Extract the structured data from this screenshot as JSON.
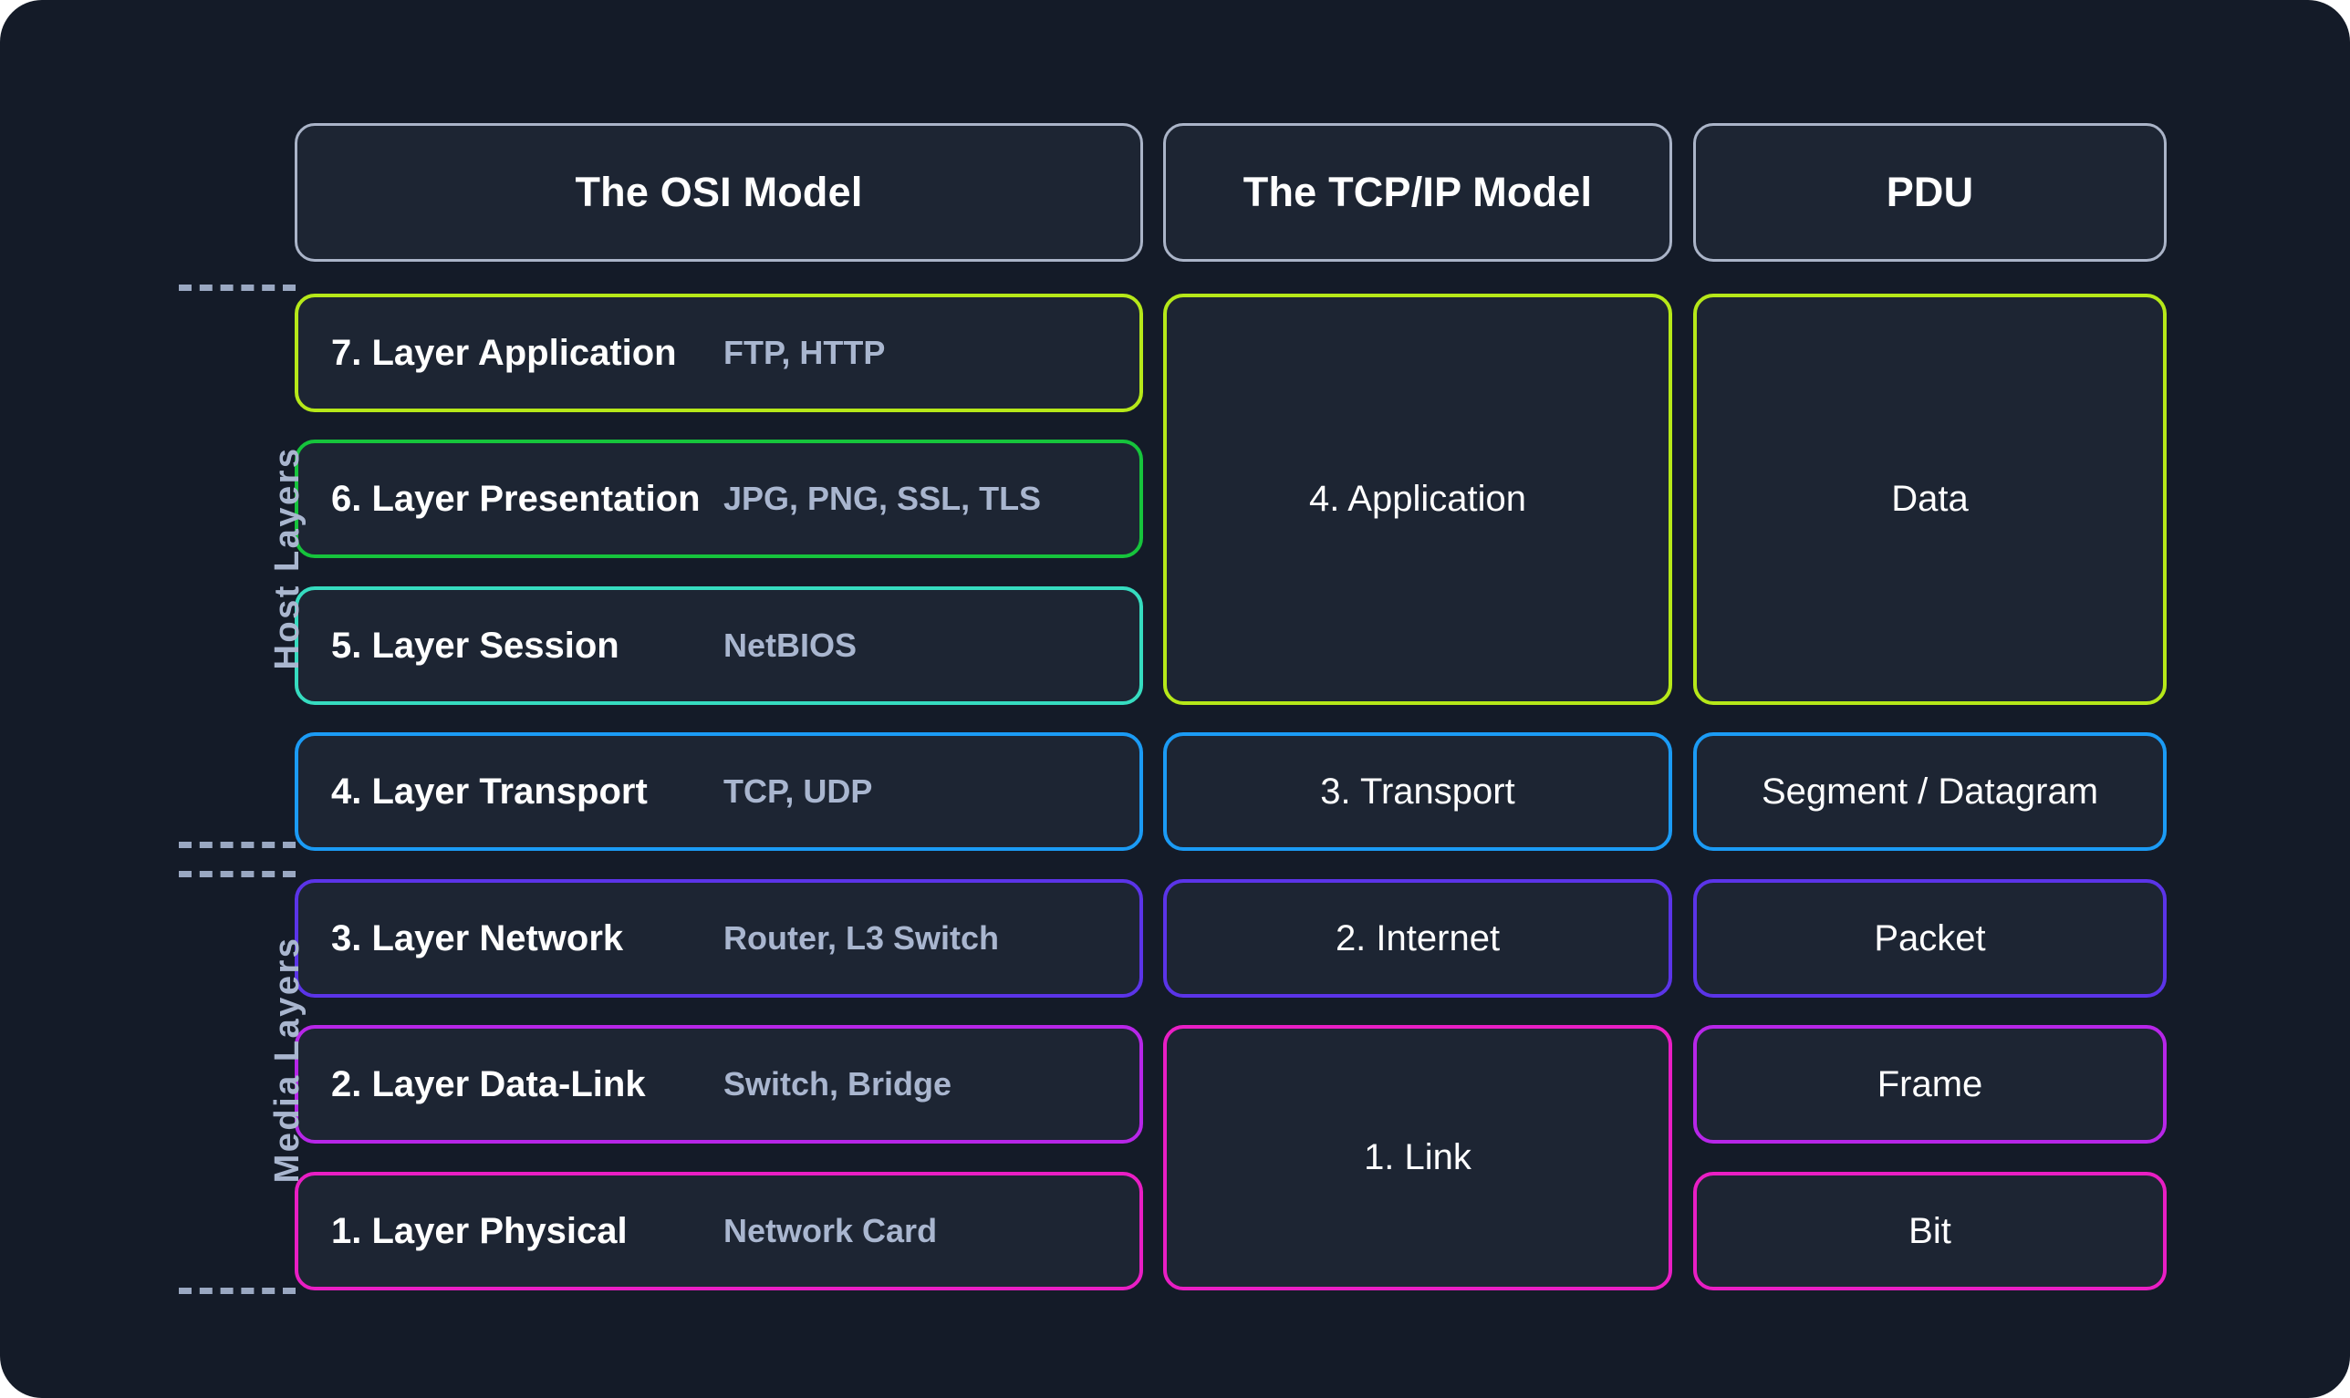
{
  "canvas": {
    "background": "#141b28",
    "box_fill": "#1d2533",
    "neutral_border": "#aab4c8",
    "muted_text": "#a9b6cf",
    "primary_text": "#ffffff"
  },
  "headers": [
    {
      "label": "The OSI Model",
      "color": "#aab4c8"
    },
    {
      "label": "The TCP/IP Model",
      "color": "#aab4c8"
    },
    {
      "label": "PDU",
      "color": "#aab4c8"
    }
  ],
  "group_labels": [
    {
      "label": "Host Layers"
    },
    {
      "label": "Media Layers"
    }
  ],
  "osi_layers": [
    {
      "name": "7. Layer Application",
      "protocols": "FTP, HTTP",
      "color": "#b6e819"
    },
    {
      "name": "6. Layer Presentation",
      "protocols": "JPG, PNG, SSL, TLS",
      "color": "#16c43c"
    },
    {
      "name": "5. Layer Session",
      "protocols": "NetBIOS",
      "color": "#36dcc0"
    },
    {
      "name": "4. Layer Transport",
      "protocols": "TCP, UDP",
      "color": "#1b9bf5"
    },
    {
      "name": "3. Layer Network",
      "protocols": "Router, L3 Switch",
      "color": "#5b34e8"
    },
    {
      "name": "2. Layer Data-Link",
      "protocols": "Switch, Bridge",
      "color": "#b726e8"
    },
    {
      "name": "1. Layer Physical",
      "protocols": "Network Card",
      "color": "#e91ec4"
    }
  ],
  "tcpip_layers": [
    {
      "label": "4. Application",
      "color": "#b6e819",
      "spans": "layers 7-5"
    },
    {
      "label": "3. Transport",
      "color": "#1b9bf5",
      "spans": "layer 4"
    },
    {
      "label": "2. Internet",
      "color": "#5b34e8",
      "spans": "layer 3"
    },
    {
      "label": "1. Link",
      "color": "#e91ec4",
      "spans": "layers 2-1"
    }
  ],
  "pdu_units": [
    {
      "label": "Data",
      "color": "#b6e819",
      "spans": "layers 7-5"
    },
    {
      "label": "Segment / Datagram",
      "color": "#1b9bf5",
      "spans": "layer 4"
    },
    {
      "label": "Packet",
      "color": "#5b34e8",
      "spans": "layer 3"
    },
    {
      "label": "Frame",
      "color": "#b726e8",
      "spans": "layer 2"
    },
    {
      "label": "Bit",
      "color": "#e91ec4",
      "spans": "layer 1"
    }
  ]
}
